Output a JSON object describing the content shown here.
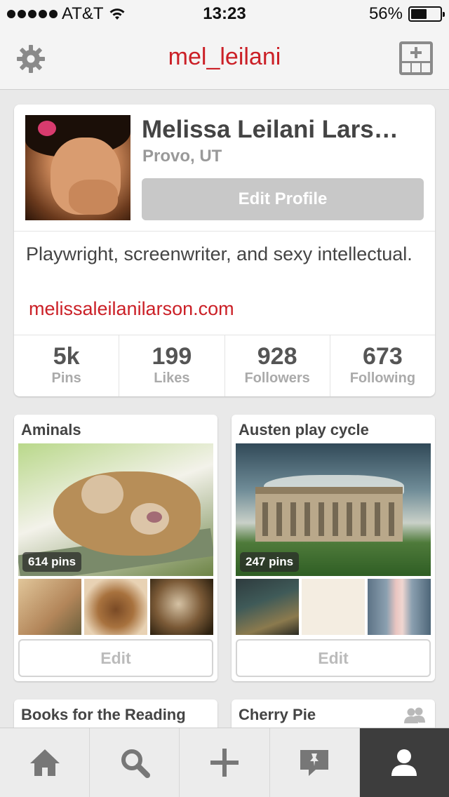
{
  "status_bar": {
    "carrier": "AT&T",
    "time": "13:23",
    "battery": "56%",
    "battery_level": 0.56
  },
  "nav": {
    "title": "mel_leilani",
    "left_icon": "gear-icon",
    "right_icon": "add-board-icon"
  },
  "profile": {
    "name": "Melissa Leilani Lars…",
    "location": "Provo, UT",
    "edit_button": "Edit Profile",
    "bio": "Playwright, screenwriter, and sexy intellectual.",
    "website": "melissaleilanilarson.com",
    "stats": [
      {
        "value": "5k",
        "label": "Pins"
      },
      {
        "value": "199",
        "label": "Likes"
      },
      {
        "value": "928",
        "label": "Followers"
      },
      {
        "value": "673",
        "label": "Following"
      }
    ]
  },
  "boards": [
    {
      "title": "Aminals",
      "pin_count": "614 pins",
      "edit_label": "Edit"
    },
    {
      "title": "Austen play cycle",
      "pin_count": "247 pins",
      "edit_label": "Edit"
    },
    {
      "title": "Books for the Reading"
    },
    {
      "title": "Cherry Pie",
      "icon": "group-board-icon"
    }
  ],
  "tabs": [
    {
      "icon": "home-icon"
    },
    {
      "icon": "search-icon"
    },
    {
      "icon": "add-pin-icon"
    },
    {
      "icon": "news-icon"
    },
    {
      "icon": "profile-icon",
      "active": true
    }
  ],
  "colors": {
    "accent": "#cb2027",
    "active_tab": "#3d3d3d"
  }
}
